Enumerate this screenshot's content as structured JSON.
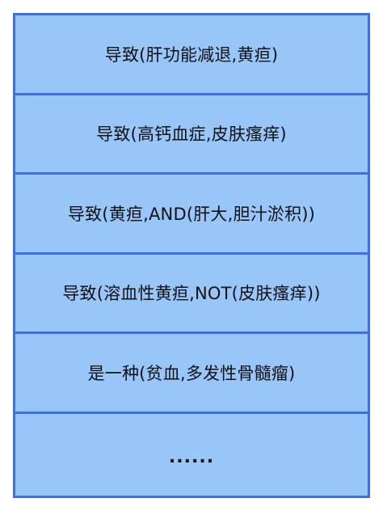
{
  "rows": [
    "导致(肝功能减退,黄疸)",
    "导致(高钙血症,皮肤瘙痒)",
    "导致(黄疸,AND(肝大,胆汁淤积))",
    "导致(溶血性黄疸,NOT(皮肤瘙痒))",
    "是一种(贫血,多发性骨髓瘤)",
    "......"
  ],
  "colors": {
    "fill": "#98c6f9",
    "border": "#3d6fe8",
    "text": "#111111"
  }
}
